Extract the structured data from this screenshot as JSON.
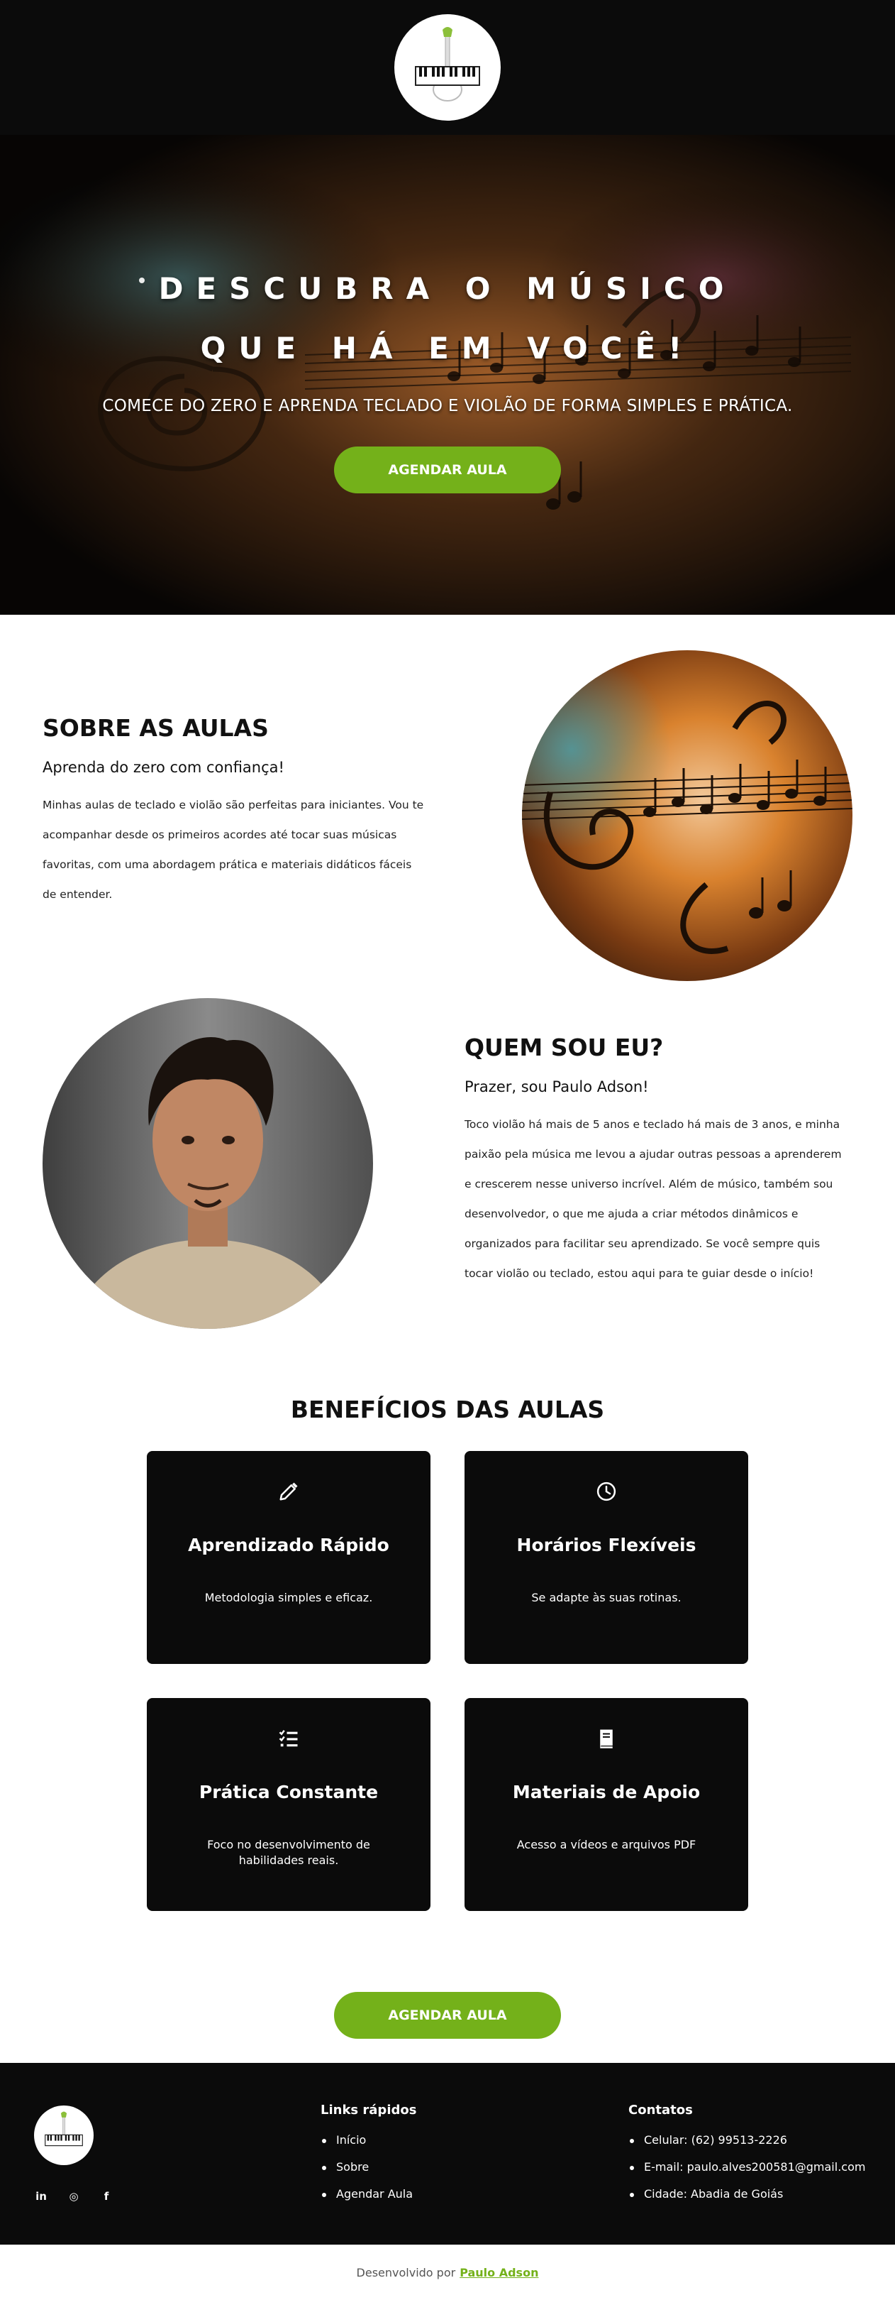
{
  "hero": {
    "title_line1": "DESCUBRA O MÚSICO",
    "title_line2": "QUE HÁ EM VOCÊ!",
    "subtitle": "COMECE DO ZERO E APRENDA TECLADO E VIOLÃO DE FORMA SIMPLES E PRÁTICA.",
    "cta_label": "AGENDAR AULA"
  },
  "about": {
    "title": "SOBRE AS AULAS",
    "subtitle": "Aprenda do zero com confiança!",
    "text_lines": [
      "Minhas aulas de teclado e violão são perfeitas para iniciantes. Vou te",
      "acompanhar desde os primeiros acordes até tocar suas músicas",
      "favoritas, com uma abordagem prática e materiais didáticos fáceis",
      "de entender."
    ]
  },
  "who": {
    "title": "QUEM SOU EU?",
    "subtitle": "Prazer, sou Paulo Adson!",
    "text_lines": [
      "Toco violão há mais de 5 anos e teclado há mais de 3 anos, e minha",
      "paixão pela música me levou a ajudar outras pessoas a aprenderem",
      "e crescerem nesse universo incrível. Além de músico, também sou",
      "desenvolvedor, o que me ajuda a criar métodos dinâmicos e",
      "organizados para facilitar seu aprendizado. Se você sempre quis",
      "tocar violão ou teclado, estou aqui para te guiar desde o início!"
    ]
  },
  "benefits": {
    "title": "BENEFÍCIOS DAS AULAS",
    "cards": [
      {
        "icon": "pencil-icon",
        "title": "Aprendizado Rápido",
        "desc": "Metodologia simples e eficaz."
      },
      {
        "icon": "clock-icon",
        "title": "Horários Flexíveis",
        "desc": "Se adapte às suas rotinas."
      },
      {
        "icon": "checklist-icon",
        "title": "Prática Constante",
        "desc": "Foco no desenvolvimento de habilidades reais."
      },
      {
        "icon": "book-icon",
        "title": "Materiais de Apoio",
        "desc": "Acesso a vídeos e arquivos PDF"
      }
    ],
    "cta_label": "AGENDAR AULA"
  },
  "footer": {
    "socials": [
      {
        "icon": "linkedin-icon",
        "glyph": "in"
      },
      {
        "icon": "instagram-icon",
        "glyph": "◎"
      },
      {
        "icon": "facebook-icon",
        "glyph": "f"
      }
    ],
    "links_title": "Links rápidos",
    "links": [
      "Início",
      "Sobre",
      "Agendar Aula"
    ],
    "contacts_title": "Contatos",
    "contacts": [
      "Celular: (62) 99513-2226",
      "E-mail: paulo.alves200581@gmail.com",
      "Cidade: Abadia de Goiás"
    ]
  },
  "credits": {
    "prefix": "Desenvolvido por",
    "author": "Paulo Adson"
  },
  "colors": {
    "accent": "#74b11a",
    "dark": "#0b0b0b"
  }
}
